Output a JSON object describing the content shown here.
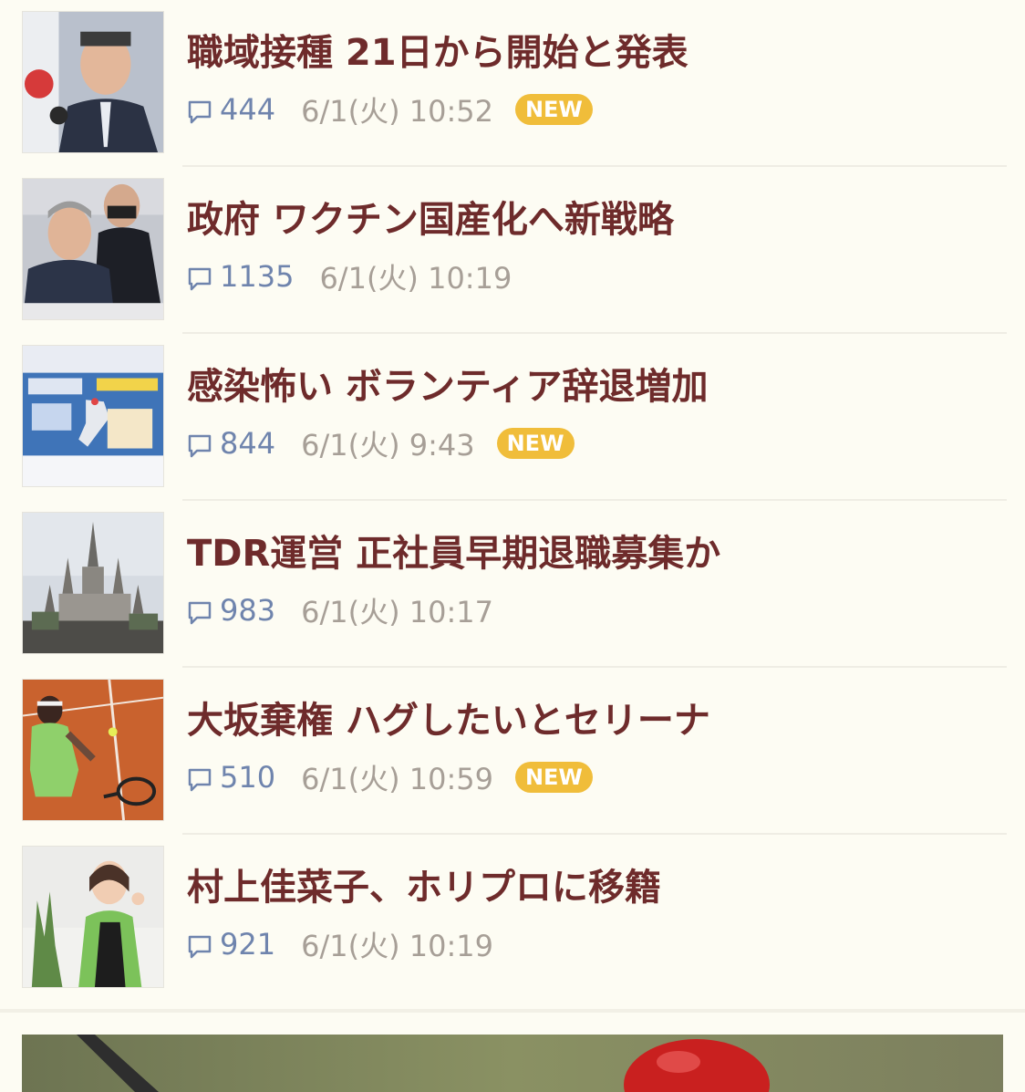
{
  "news_items": [
    {
      "title": "職域接種 21日から開始と発表",
      "comments": "444",
      "time": "6/1(火) 10:52",
      "badge": "NEW",
      "image": "press-conference-photo"
    },
    {
      "title": "政府 ワクチン国産化へ新戦略",
      "comments": "1135",
      "time": "6/1(火) 10:19",
      "badge": "",
      "image": "government-meeting-photo"
    },
    {
      "title": "感染怖い ボランティア辞退増加",
      "comments": "844",
      "time": "6/1(火) 9:43",
      "badge": "NEW",
      "image": "tv-map-screenshot"
    },
    {
      "title": "TDR運営 正社員早期退職募集か",
      "comments": "983",
      "time": "6/1(火) 10:17",
      "badge": "",
      "image": "castle-photo"
    },
    {
      "title": "大坂棄権 ハグしたいとセリーナ",
      "comments": "510",
      "time": "6/1(火) 10:59",
      "badge": "NEW",
      "image": "tennis-player-photo"
    },
    {
      "title": "村上佳菜子、ホリプロに移籍",
      "comments": "921",
      "time": "6/1(火) 10:19",
      "badge": "",
      "image": "woman-portrait-photo"
    }
  ],
  "icons": {
    "comment": "speech-bubble-icon"
  },
  "colors": {
    "background": "#fdfcf3",
    "headline": "#6e2b2b",
    "comment_count": "#6f84ad",
    "timestamp": "#a79f97",
    "new_badge": "#f0bd3a"
  },
  "banner": {
    "image": "baseball-banner-photo"
  }
}
